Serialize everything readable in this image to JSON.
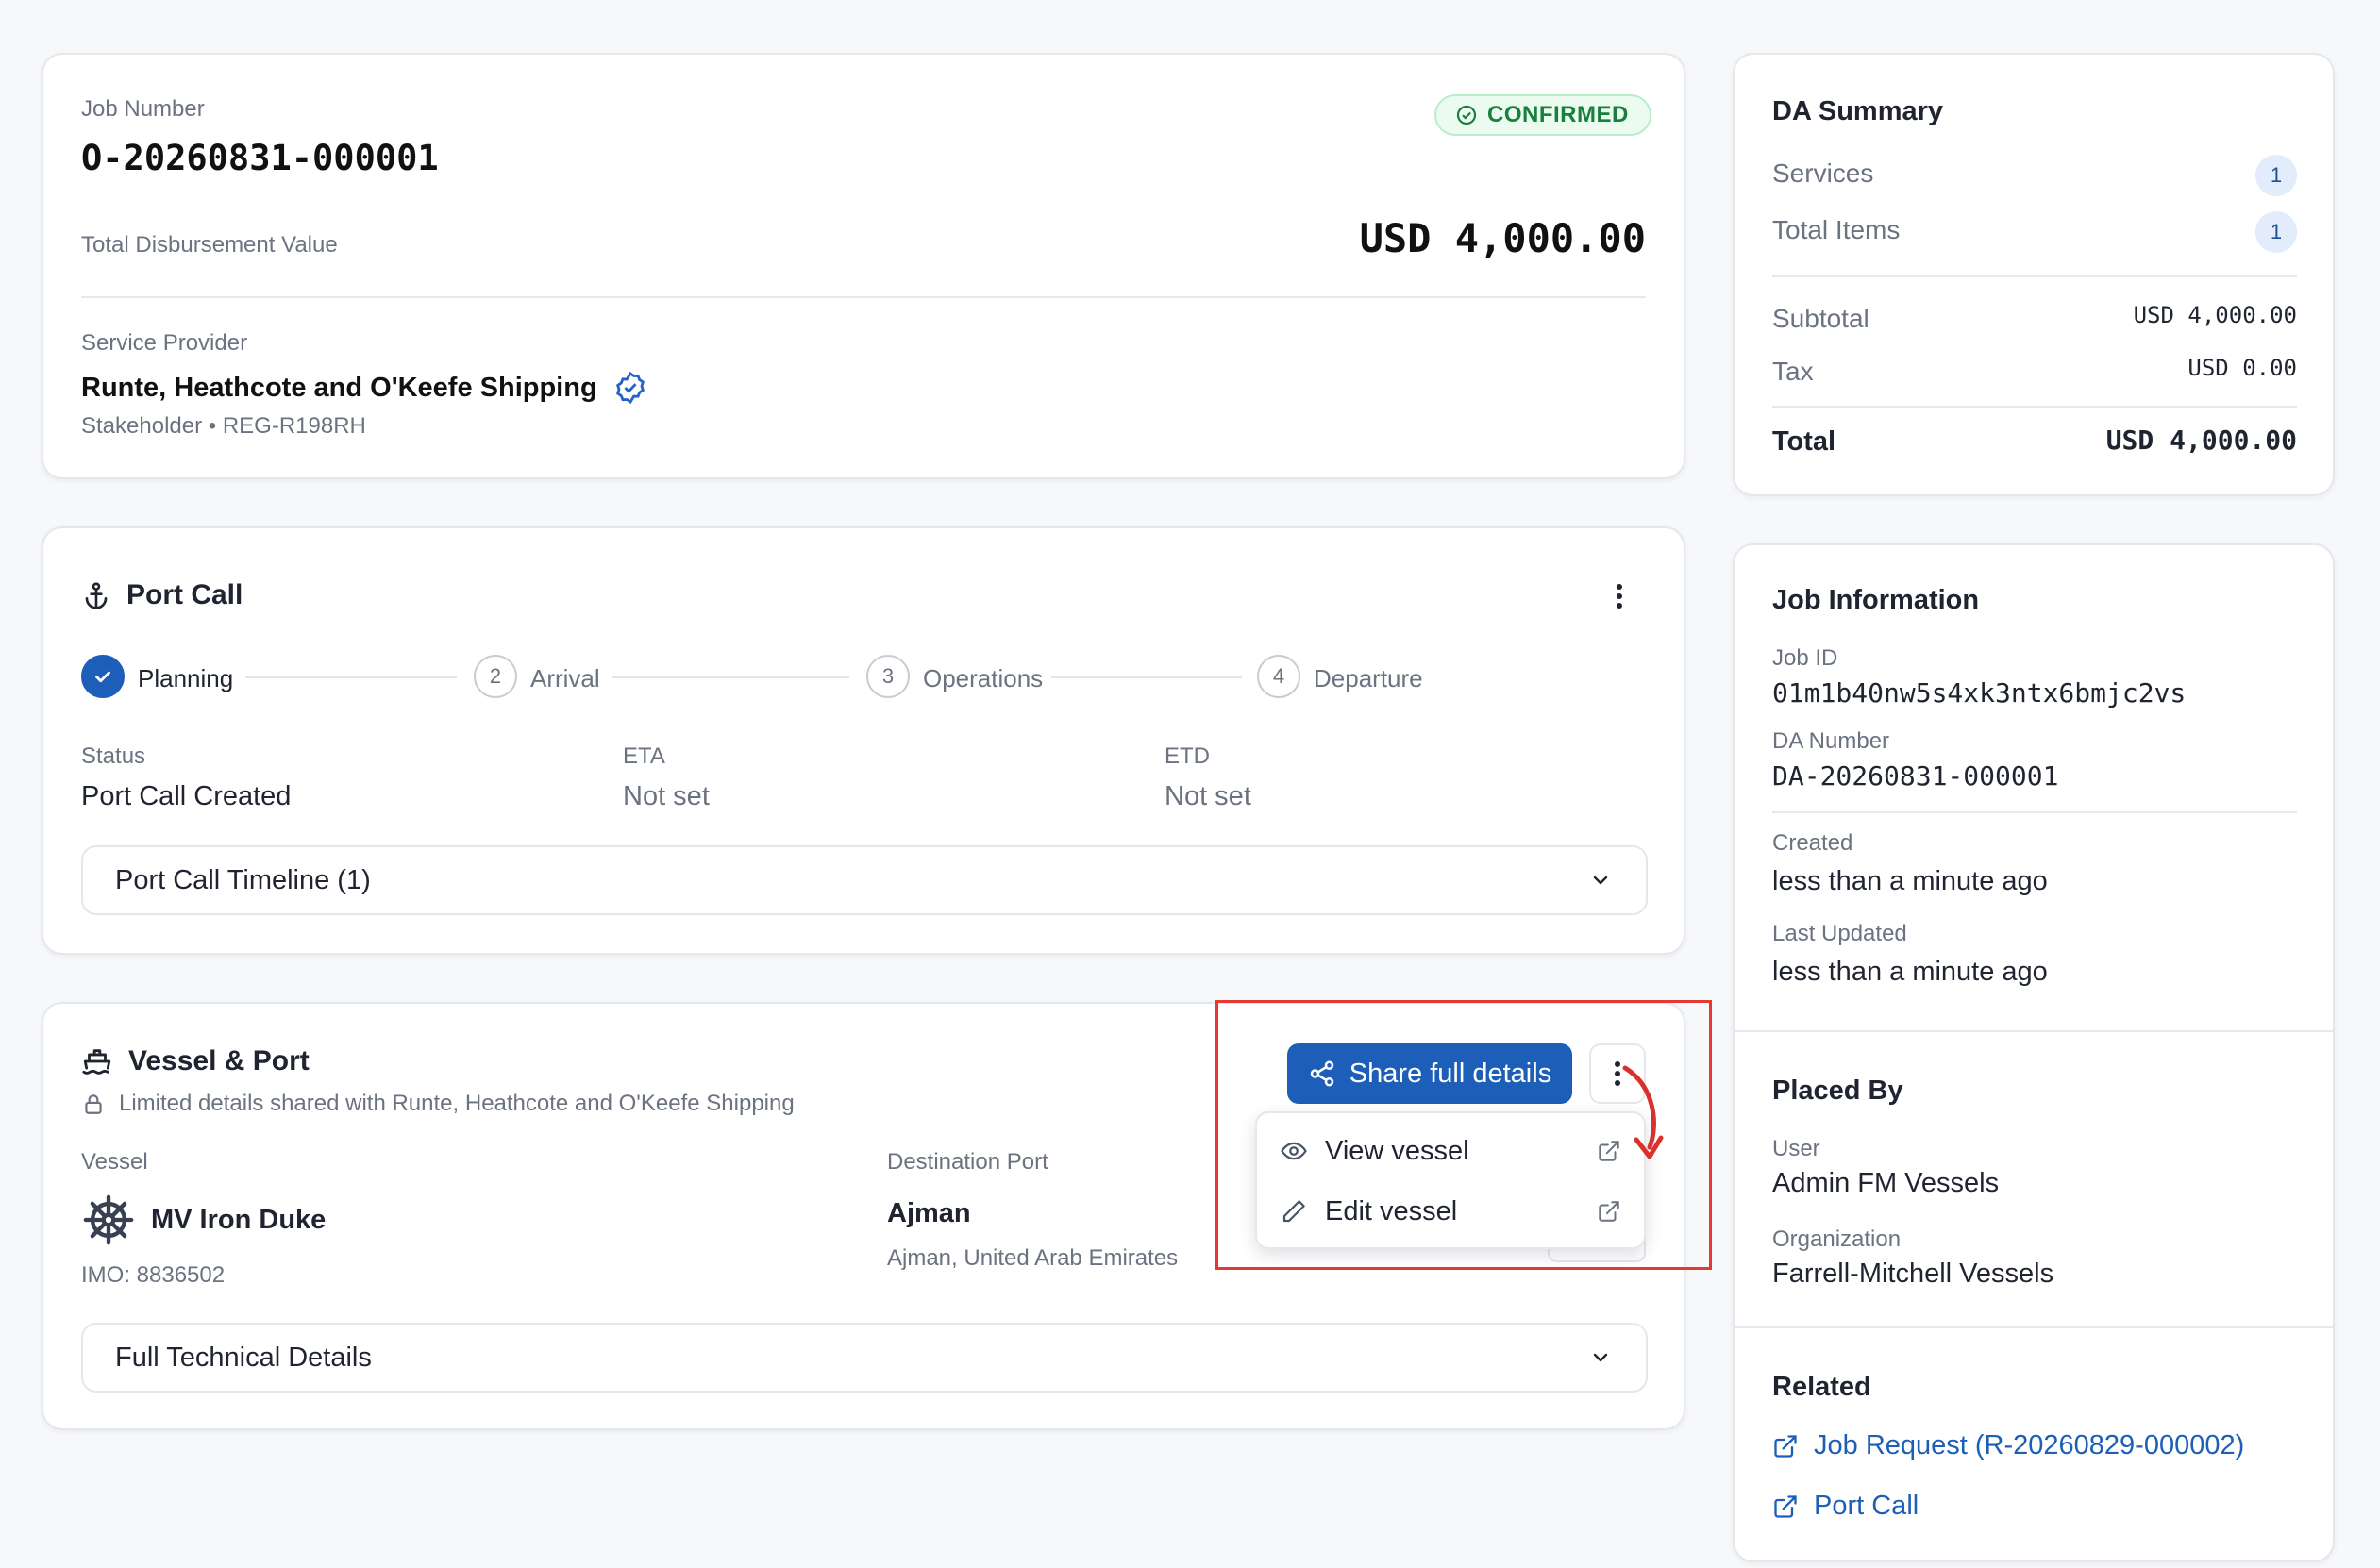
{
  "job": {
    "number_label": "Job Number",
    "number": "O-20260831-000001",
    "status": "CONFIRMED",
    "total_label": "Total Disbursement Value",
    "total_value": "USD 4,000.00",
    "provider_label": "Service Provider",
    "provider_name": "Runte, Heathcote and O'Keefe Shipping",
    "provider_meta": "Stakeholder • REG-R198RH"
  },
  "port_call": {
    "title": "Port Call",
    "steps": [
      {
        "number": "",
        "label": "Planning",
        "done": true
      },
      {
        "number": "2",
        "label": "Arrival",
        "done": false
      },
      {
        "number": "3",
        "label": "Operations",
        "done": false
      },
      {
        "number": "4",
        "label": "Departure",
        "done": false
      }
    ],
    "status_label": "Status",
    "status_value": "Port Call Created",
    "eta_label": "ETA",
    "eta_value": "Not set",
    "etd_label": "ETD",
    "etd_value": "Not set",
    "timeline_label": "Port Call Timeline (1)"
  },
  "vessel_port": {
    "title": "Vessel & Port",
    "shared_note": "Limited details shared with Runte, Heathcote and O'Keefe Shipping",
    "share_button": "Share full details",
    "menu": {
      "view": "View vessel",
      "edit": "Edit vessel"
    },
    "vessel_label": "Vessel",
    "vessel_name": "MV Iron Duke",
    "imo": "IMO: 8836502",
    "destination_label": "Destination Port",
    "destination_name": "Ajman",
    "destination_location": "Ajman, United Arab Emirates",
    "technical_label": "Full Technical Details"
  },
  "da_summary": {
    "title": "DA Summary",
    "services_label": "Services",
    "services_count": "1",
    "items_label": "Total Items",
    "items_count": "1",
    "subtotal_label": "Subtotal",
    "subtotal_value": "USD 4,000.00",
    "tax_label": "Tax",
    "tax_value": "USD 0.00",
    "total_label": "Total",
    "total_value": "USD 4,000.00"
  },
  "job_info": {
    "title": "Job Information",
    "job_id_label": "Job ID",
    "job_id": "01m1b40nw5s4xk3ntx6bmjc2vs",
    "da_number_label": "DA Number",
    "da_number": "DA-20260831-000001",
    "created_label": "Created",
    "created_value": "less than a minute ago",
    "updated_label": "Last Updated",
    "updated_value": "less than a minute ago"
  },
  "placed_by": {
    "title": "Placed By",
    "user_label": "User",
    "user_value": "Admin FM Vessels",
    "org_label": "Organization",
    "org_value": "Farrell-Mitchell Vessels"
  },
  "related": {
    "title": "Related",
    "links": [
      "Job Request (R-20260829-000002)",
      "Port Call"
    ]
  },
  "colors": {
    "primary": "#1d5fb8",
    "success": "#16803c",
    "highlight": "#e53935"
  }
}
